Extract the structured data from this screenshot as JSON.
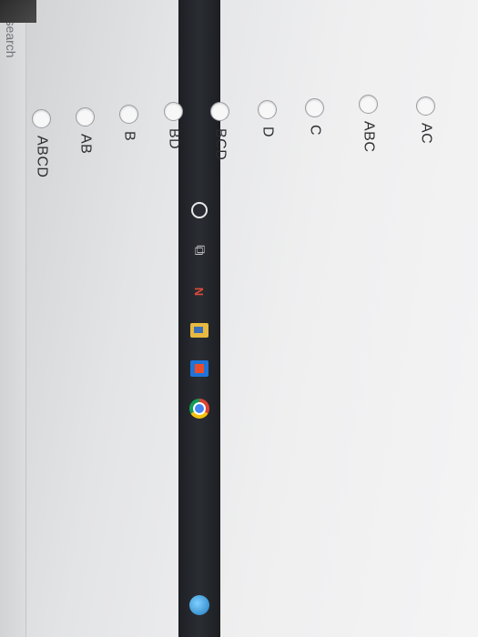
{
  "taskbar": {
    "search_text": "to search",
    "icons": [
      "cortana-icon",
      "task-view-icon",
      "app-n-icon",
      "file-explorer-icon",
      "office-icon",
      "chrome-icon",
      "tray-app-icon"
    ]
  },
  "question": {
    "options": [
      {
        "label": "AC",
        "selected": false
      },
      {
        "label": "ABC",
        "selected": false
      },
      {
        "label": "C",
        "selected": false
      },
      {
        "label": "D",
        "selected": false
      },
      {
        "label": "BCD",
        "selected": false
      },
      {
        "label": "BD",
        "selected": false
      },
      {
        "label": "B",
        "selected": false
      },
      {
        "label": "AB",
        "selected": false
      },
      {
        "label": "ABCD",
        "selected": false
      }
    ]
  }
}
